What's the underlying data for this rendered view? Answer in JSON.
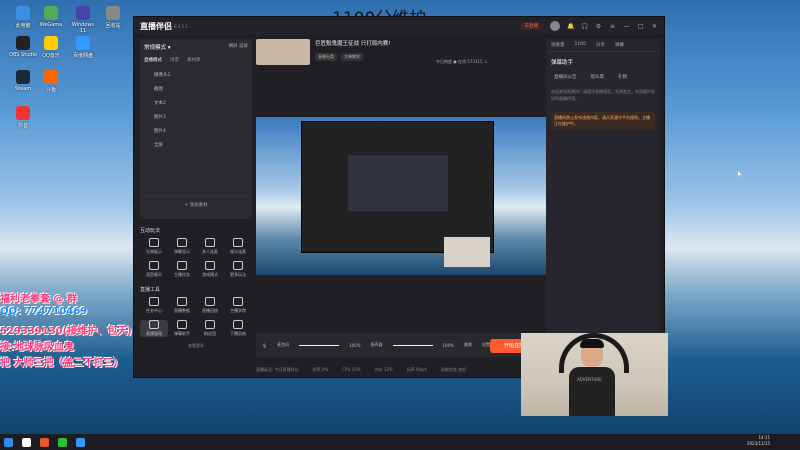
{
  "overlay": {
    "title": "1100分维护",
    "lines": [
      "福利老拳套 @ 群",
      "QQ: 774710469",
      "529339130(接维护、包天)",
      "接:地球脉吸血鬼",
      "把   大师三把（盖二不打三）"
    ]
  },
  "desktop": {
    "icons": [
      {
        "label": "此电脑",
        "color": "#3a8ee6"
      },
      {
        "label": "WeGame",
        "color": "#5a5"
      },
      {
        "label": "Windows 11",
        "color": "#44a"
      },
      {
        "label": "回收站",
        "color": "#888"
      },
      {
        "label": "OBS Studio",
        "color": "#222"
      },
      {
        "label": "QQ音乐",
        "color": "#fc0"
      },
      {
        "label": "百度网盘",
        "color": "#39f"
      },
      {
        "label": "Steam",
        "color": "#1b2838"
      },
      {
        "label": "斗鱼",
        "color": "#f60"
      },
      {
        "label": "抖音",
        "color": "#e33"
      }
    ]
  },
  "app": {
    "logo": "直播伴侣",
    "version": "6.4.5.1",
    "head": {
      "pill": "去直播",
      "icons": [
        "bell-icon",
        "headphone-icon",
        "settings-icon",
        "menu-icon"
      ],
      "window_controls": [
        "—",
        "□",
        "✕"
      ]
    },
    "scene": {
      "title": "常规模式 ▾",
      "mode_label": "横屏 竖屏",
      "tabs": [
        "直播模式",
        "场景",
        "素材库"
      ],
      "sources": [
        "摄像头1",
        "截图",
        "文本2",
        "图片3",
        "图片4",
        "全屏"
      ],
      "add_source": "+ 添加素材"
    },
    "interaction": {
      "title": "互动玩法",
      "items": [
        "礼物展示",
        "弹幕显示",
        "多人连麦",
        "观众连麦",
        "语音聊天",
        "主播任务",
        "游戏模式",
        "更多玩法"
      ]
    },
    "tools": {
      "title": "直播工具",
      "items": [
        "任务中心",
        "直播数据",
        "直播回放",
        "主播学院",
        "直播管理",
        "弹幕助手",
        "粉丝团",
        "下播总结"
      ],
      "more": "查看更多"
    },
    "stream": {
      "title": "巨匠魁鬼魔王征战 只打局内赛!",
      "tags": [
        "直播分类",
        "大神教学"
      ],
      "status": "今日热度 ● 在线 573115 人"
    },
    "controls": {
      "mic_label": "麦克风",
      "mic_volume": "100%",
      "speaker_label": "扬声器",
      "speaker_volume": "100%",
      "btn1": "美颜",
      "btn2": "设置",
      "btn3": "更多",
      "start": "开始直播"
    },
    "statusbar": [
      "直播延迟: 今日直播时长",
      "帧率 0%",
      "CPU 10%",
      "内存 13%",
      "码率 0kb/s",
      "网络状态 良好"
    ],
    "right": {
      "tabs": [
        "观看量",
        "1100",
        "分享",
        "弹幕"
      ],
      "header": "弹幕助手",
      "buttons": [
        "直播间公告",
        "观众席",
        "礼物"
      ],
      "text": "欢迎来到直播间！请遵守直播规范，文明发言，共同维护良好的直播环境。",
      "box": "直播间禁止发布违规内容，请大家遵守平台规则。主播正在维护中。"
    }
  },
  "taskbar": {
    "time": "14:11",
    "date": "2023/11/15"
  }
}
